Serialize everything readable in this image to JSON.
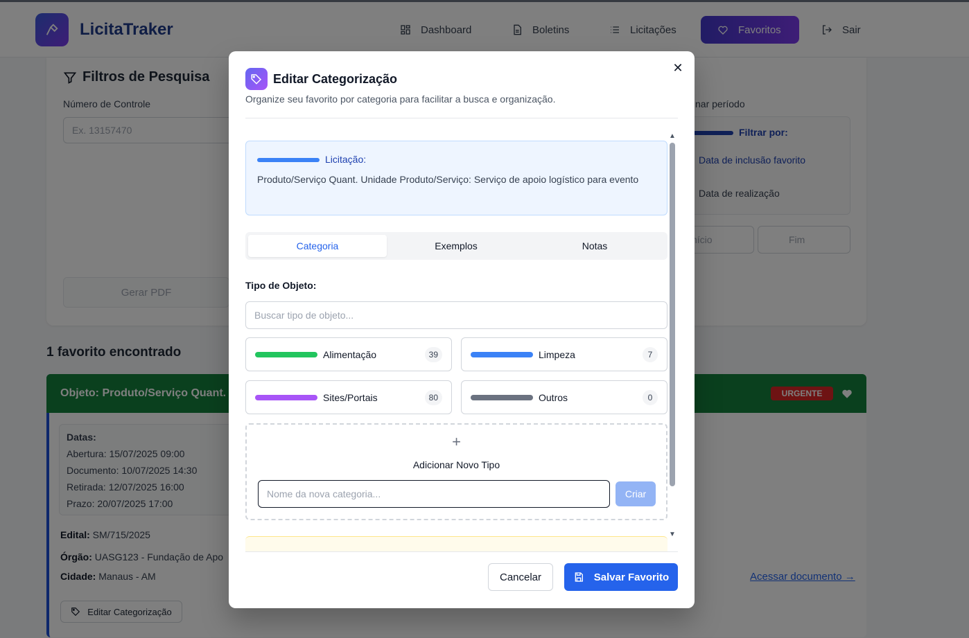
{
  "header": {
    "brand": "LicitaTraker",
    "nav": [
      {
        "label": "Dashboard",
        "icon": "grid-icon"
      },
      {
        "label": "Boletins",
        "icon": "file-icon"
      },
      {
        "label": "Licitações",
        "icon": "list-icon"
      },
      {
        "label": "Favoritos",
        "icon": "heart-icon"
      },
      {
        "label": "Sair",
        "icon": "logout-icon"
      }
    ]
  },
  "filters": {
    "title": "Filtros de Pesquisa",
    "control_label": "Número de Controle",
    "control_placeholder": "Ex. 13157470",
    "period_label": "nar período",
    "filter_by": "Filtrar por:",
    "option_inclusion": "Data de inclusão favorito",
    "option_realization": "Data de realização",
    "start_placeholder": "nício",
    "end_placeholder": "Fim",
    "pdf_button": "Gerar PDF"
  },
  "results": {
    "count_text": "1 favorito encontrado",
    "card": {
      "title": "Objeto: Produto/Serviço Quant.",
      "badge": "URGENTE",
      "dates_title": "Datas:",
      "dates": [
        "Abertura: 15/07/2025 09:00",
        "Documento: 10/07/2025 14:30",
        "Retirada: 12/07/2025 16:00",
        "Prazo: 20/07/2025 17:00"
      ],
      "edital_label": "Edital:",
      "edital_value": "SM/715/2025",
      "orgao_label": "Órgão:",
      "orgao_value": "UASG123 - Fundação de Apo",
      "cidade_label": "Cidade:",
      "cidade_value": "Manaus - AM",
      "doc_link": "Acessar documento →",
      "edit_button": "Editar Categorização"
    }
  },
  "modal": {
    "title": "Editar Categorização",
    "subtitle": "Organize seu favorito por categoria para facilitar a busca e organização.",
    "licitacao_label": "Licitação:",
    "licitacao_text": "Produto/Serviço Quant. Unidade Produto/Serviço: Serviço de apoio logístico para evento",
    "tabs": [
      "Categoria",
      "Exemplos",
      "Notas"
    ],
    "active_tab": "Categoria",
    "tipo_label": "Tipo de Objeto:",
    "search_placeholder": "Buscar tipo de objeto...",
    "categories": [
      {
        "name": "Alimentação",
        "count": "39",
        "color": "#22c55e"
      },
      {
        "name": "Limpeza",
        "count": "7",
        "color": "#3b82f6"
      },
      {
        "name": "Sites/Portais",
        "count": "80",
        "color": "#a855f7"
      },
      {
        "name": "Outros",
        "count": "0",
        "color": "#6b7280"
      }
    ],
    "add_label": "Adicionar Novo Tipo",
    "new_placeholder": "Nome da nova categoria...",
    "create_button": "Criar",
    "cancel_button": "Cancelar",
    "save_button": "Salvar Favorito"
  }
}
